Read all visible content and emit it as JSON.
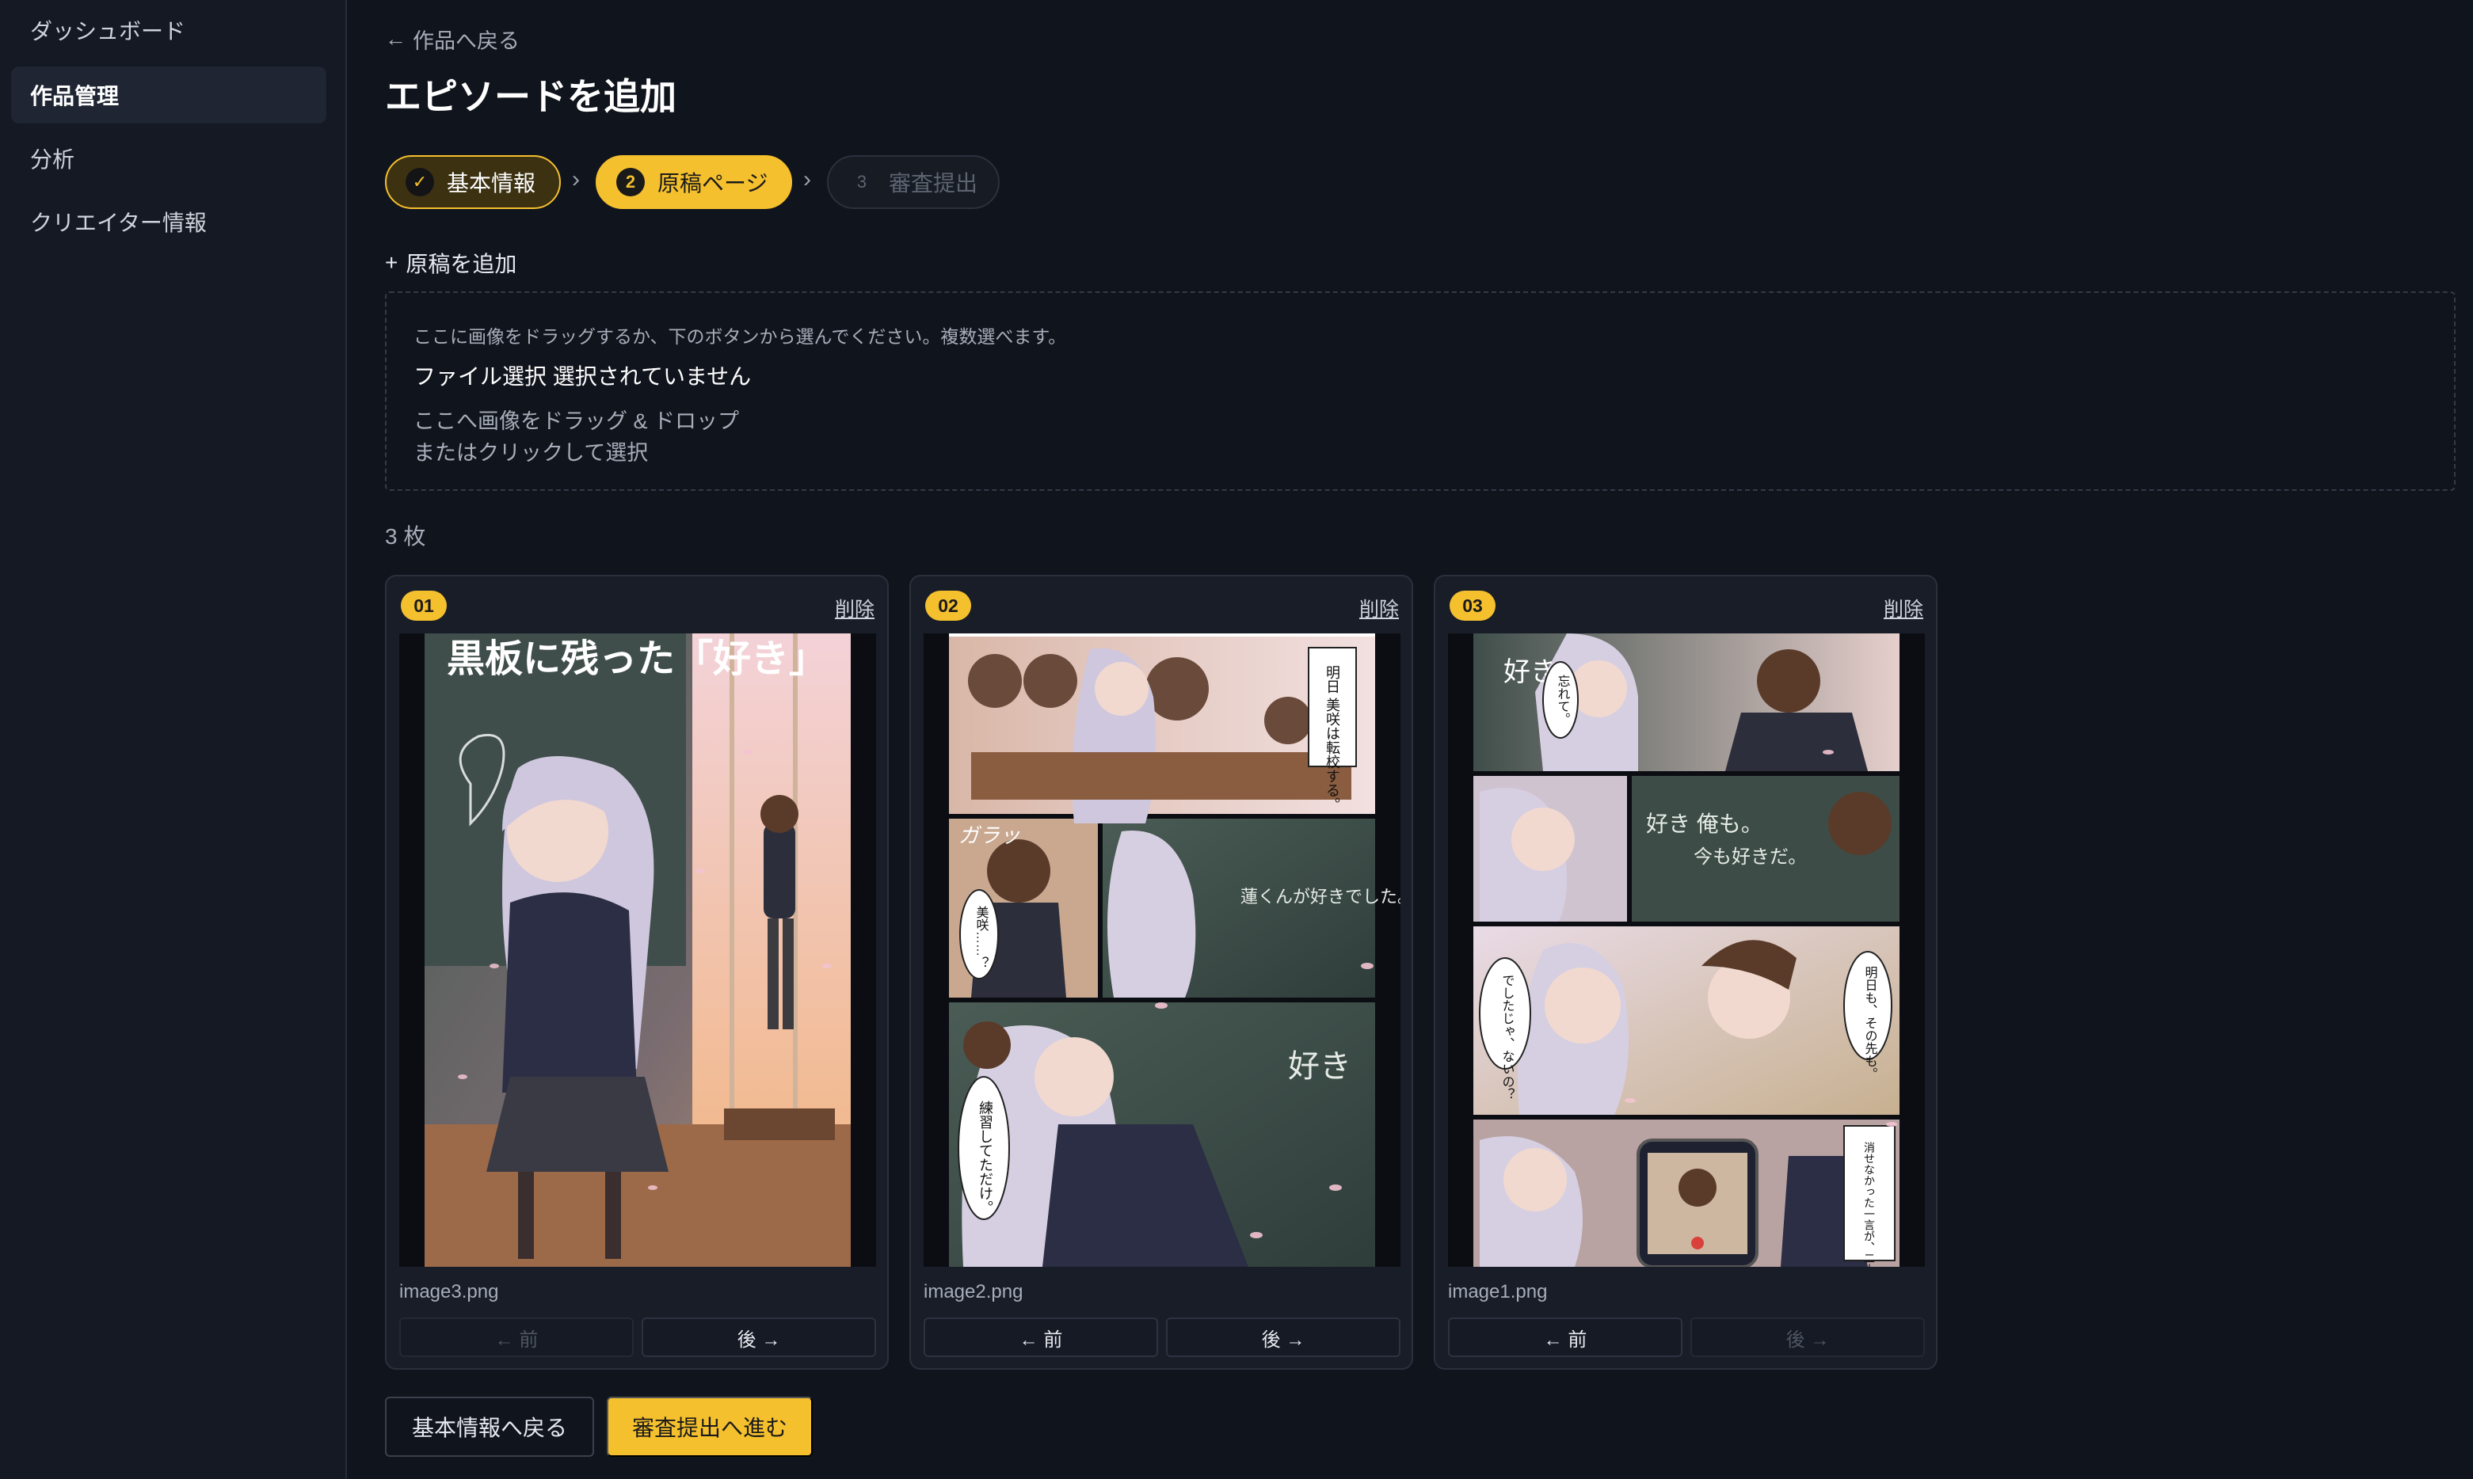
{
  "sidebar": {
    "items": [
      {
        "label": "ダッシュボード"
      },
      {
        "label": "作品管理"
      },
      {
        "label": "分析"
      },
      {
        "label": "クリエイター情報"
      }
    ]
  },
  "header": {
    "back_arrow": "←",
    "back_label": "作品へ戻る",
    "title": "エピソードを追加"
  },
  "steps": [
    {
      "mark": "✓",
      "label": "基本情報",
      "state": "done"
    },
    {
      "mark": "2",
      "label": "原稿ページ",
      "state": "current"
    },
    {
      "mark": "3",
      "label": "審査提出",
      "state": "pending"
    }
  ],
  "step_separator": "›",
  "upload": {
    "add_icon": "+",
    "add_label": "原稿を追加",
    "hint": "ここに画像をドラッグするか、下のボタンから選んでください。複数選べます。",
    "file_status": "ファイル選択 選択されていません",
    "drop_line1": "ここへ画像をドラッグ & ドロップ",
    "drop_line2": "またはクリックして選択"
  },
  "pages_count": "3 枚",
  "pages": [
    {
      "number": "01",
      "delete": "削除",
      "filename": "image3.png",
      "prev": "← 前",
      "next": "後 →",
      "image": {
        "title": "黒板に残った「好き」"
      }
    },
    {
      "number": "02",
      "delete": "削除",
      "filename": "image2.png",
      "prev": "← 前",
      "next": "後 →",
      "image": {
        "bubbles": [
          "明日 美咲は転校する。",
          "美咲……？",
          "練習してただけ。"
        ],
        "sfx": "ガラッ",
        "chalk": [
          "蓮くんが好きでした。",
          "好き"
        ]
      }
    },
    {
      "number": "03",
      "delete": "削除",
      "filename": "image1.png",
      "prev": "← 前",
      "next": "後 →",
      "image": {
        "bubbles": [
          "忘れて。",
          "でしたじゃ、ないの？",
          "明日も、その先も。",
          "消せなかった一言が、二人の明日をつないだ。"
        ],
        "chalk": [
          "好き",
          "好き 俺も。",
          "今も好きだ。"
        ]
      }
    }
  ],
  "footer": {
    "back_label": "基本情報へ戻る",
    "next_label": "審査提出へ進む"
  },
  "colors": {
    "accent": "#f5c02e",
    "background": "#10141d",
    "sidebar": "#141923",
    "card": "#181d28"
  },
  "icons": {
    "back": "arrow-left-icon",
    "check": "check-icon",
    "add": "plus-icon",
    "separator": "chevron-right-icon"
  }
}
